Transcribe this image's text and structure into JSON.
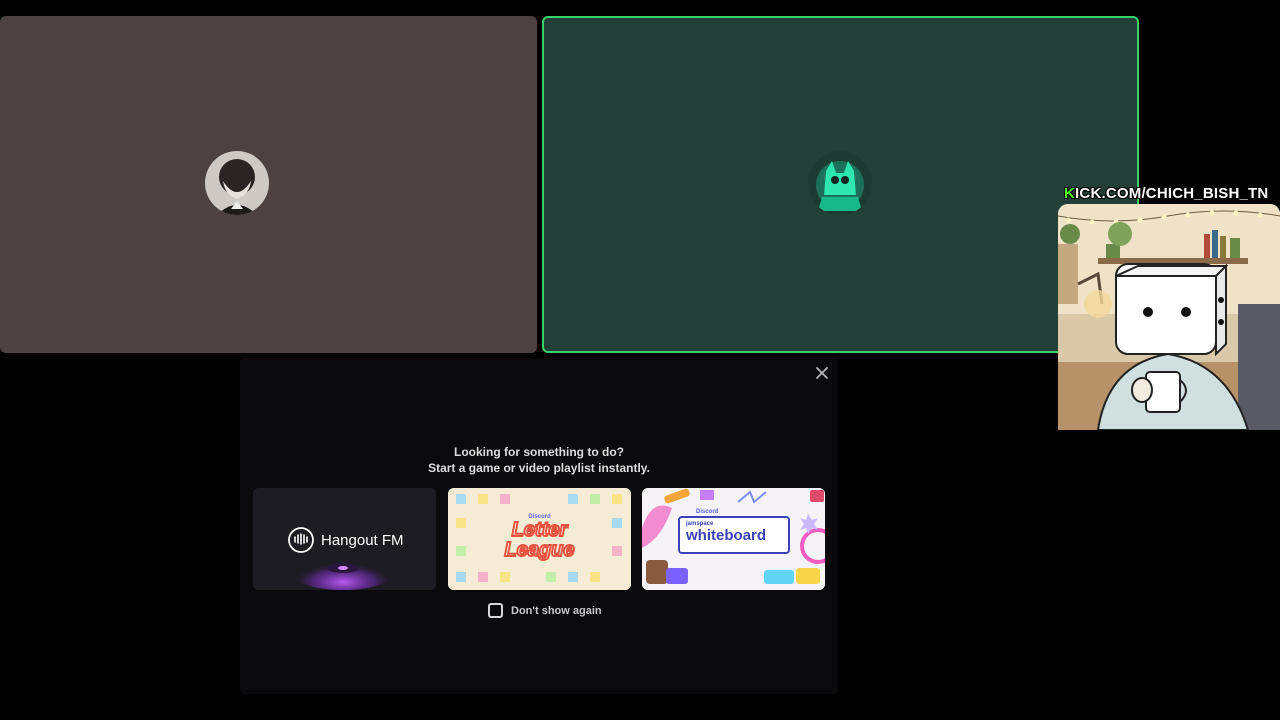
{
  "participants": [
    {
      "id": "user-left",
      "tile_color": "#4d4242",
      "speaking": false
    },
    {
      "id": "user-right",
      "tile_color": "#234038",
      "speaking": true,
      "speaking_color": "#3bd16a"
    }
  ],
  "activity_panel": {
    "heading_line1": "Looking for something to do?",
    "heading_line2": "Start a game or video playlist instantly.",
    "close_icon": "close-icon",
    "activities": [
      {
        "name": "Hangout FM",
        "logo_text": "Hangout FM"
      },
      {
        "name": "Letter League",
        "logo_line1": "Letter",
        "logo_line2": "League",
        "brand": "Discord"
      },
      {
        "name": "Jamspace Whiteboard",
        "logo_small": "jamspace",
        "logo_text": "whiteboard",
        "brand": "Discord"
      }
    ],
    "dont_show_label": "Don't show again"
  },
  "overlay": {
    "kick_url": "KICK.COM/CHICH_BISH_TN",
    "kick_color": "#53fc18"
  }
}
